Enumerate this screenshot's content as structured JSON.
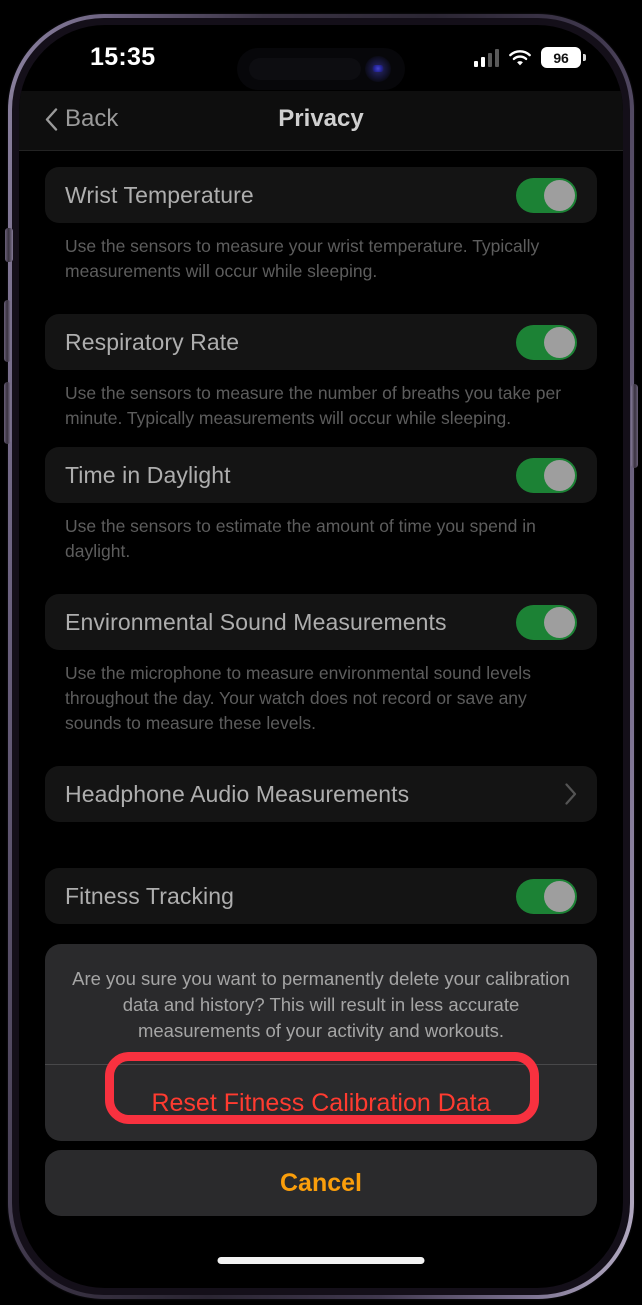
{
  "status_bar": {
    "time": "15:35",
    "battery_percent": "96",
    "signal_icon": "cellular-signal-icon",
    "wifi_icon": "wifi-icon",
    "battery_icon": "battery-icon",
    "signal_bars_active": 2,
    "signal_bars_total": 4
  },
  "nav": {
    "back_label": "Back",
    "title": "Privacy",
    "back_icon": "chevron-left-icon"
  },
  "settings": {
    "groups": [
      {
        "label": "Wrist Temperature",
        "control": "toggle",
        "toggle_on": true,
        "footnote": "Use the sensors to measure your wrist temperature. Typically measurements will occur while sleeping."
      },
      {
        "label": "Respiratory Rate",
        "control": "toggle",
        "toggle_on": true,
        "footnote": "Use the sensors to measure the number of breaths you take per minute. Typically measurements will occur while sleeping."
      },
      {
        "label": "Time in Daylight",
        "control": "toggle",
        "toggle_on": true,
        "footnote": "Use the sensors to estimate the amount of time you spend in daylight."
      },
      {
        "label": "Environmental Sound Measurements",
        "control": "toggle",
        "toggle_on": true,
        "footnote": "Use the microphone to measure environmental sound levels throughout the day. Your watch does not record or save any sounds to measure these levels."
      },
      {
        "label": "Headphone Audio Measurements",
        "control": "disclosure",
        "footnote": ""
      },
      {
        "label": "Fitness Tracking",
        "control": "toggle",
        "toggle_on": true,
        "footnote": ""
      }
    ]
  },
  "action_sheet": {
    "message": "Are you sure you want to permanently delete your calibration data and history? This will result in less accurate measurements of your activity and workouts.",
    "destructive_label": "Reset Fitness Calibration Data",
    "cancel_label": "Cancel"
  },
  "colors": {
    "toggle_on": "#1c8235",
    "toggle_knob": "#9e9e9e",
    "destructive": "#ff3b30",
    "cancel": "#fa9e0b",
    "annotation_highlight": "#f8313f",
    "sheet_background": "#2a2a2c",
    "row_background": "#141414",
    "frame_purple": "#6c6280"
  }
}
